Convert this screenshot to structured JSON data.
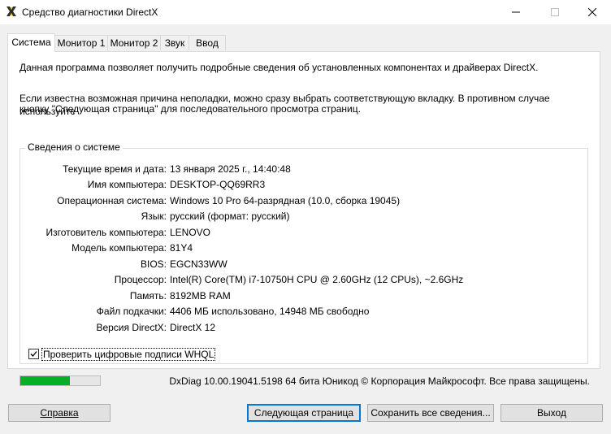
{
  "window": {
    "title": "Средство диагностики DirectX"
  },
  "tabs": [
    {
      "label": "Система"
    },
    {
      "label": "Монитор 1"
    },
    {
      "label": "Монитор 2"
    },
    {
      "label": "Звук"
    },
    {
      "label": "Ввод"
    }
  ],
  "intro": {
    "line1": "Данная программа позволяет получить подробные сведения об установленных компонентах и драйверах DirectX.",
    "line2": "Если известна возможная причина неполадки, можно сразу выбрать соответствующую вкладку. В противном случае используйте",
    "line3": "кнопку \"Следующая страница\" для последовательного просмотра страниц."
  },
  "system_info": {
    "group_title": "Сведения о системе",
    "rows": [
      {
        "label": "Текущие время и дата:",
        "value": "13 января 2025 г., 14:40:48"
      },
      {
        "label": "Имя компьютера:",
        "value": "DESKTOP-QQ69RR3"
      },
      {
        "label": "Операционная система:",
        "value": "Windows 10 Pro 64-разрядная (10.0, сборка 19045)"
      },
      {
        "label": "Язык:",
        "value": "русский (формат: русский)"
      },
      {
        "label": "Изготовитель компьютера:",
        "value": "LENOVO"
      },
      {
        "label": "Модель компьютера:",
        "value": "81Y4"
      },
      {
        "label": "BIOS:",
        "value": "EGCN33WW"
      },
      {
        "label": "Процессор:",
        "value": "Intel(R) Core(TM) i7-10750H CPU @ 2.60GHz (12 CPUs), ~2.6GHz"
      },
      {
        "label": "Память:",
        "value": "8192MB RAM"
      },
      {
        "label": "Файл подкачки:",
        "value": "4406 МБ использовано, 14948 МБ свободно"
      },
      {
        "label": "Версия DirectX:",
        "value": "DirectX 12"
      }
    ],
    "whql_label": "Проверить цифровые подписи WHQL",
    "whql_checked": true
  },
  "status": {
    "progress_percent": 62,
    "progress_color": "#06b025",
    "footer_text": "DxDiag 10.00.19041.5198 64 бита Юникод © Корпорация Майкрософт. Все права защищены."
  },
  "buttons": {
    "help_label": "Справка",
    "next_label": "Следующая страница",
    "save_label": "Сохранить все сведения...",
    "exit_label": "Выход"
  },
  "icons": {
    "app": "directx-x-icon",
    "minimize": "minimize-icon",
    "maximize": "maximize-icon",
    "close": "close-icon",
    "check": "checkmark-icon"
  }
}
